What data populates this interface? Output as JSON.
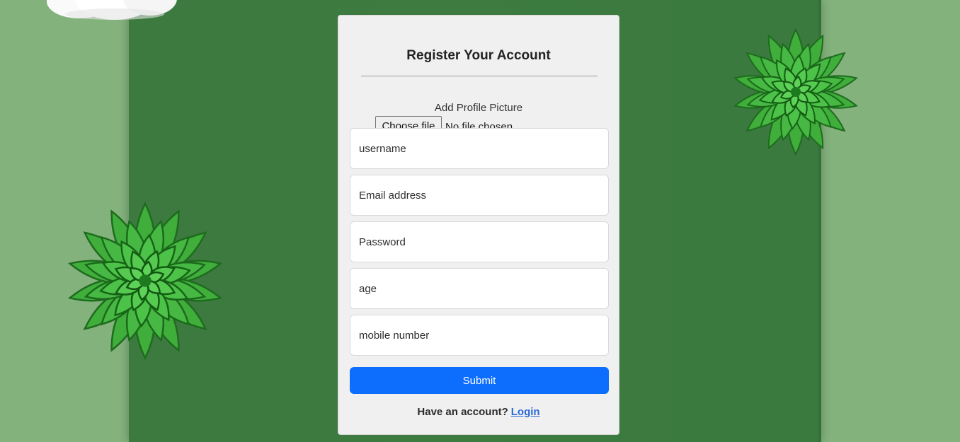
{
  "form": {
    "title": "Register Your Account",
    "profile_picture_label": "Add Profile Picture",
    "choose_file_label": "Choose file",
    "file_status": "No file chosen",
    "fields": [
      {
        "placeholder": "username",
        "value": ""
      },
      {
        "placeholder": "Email address",
        "value": ""
      },
      {
        "placeholder": "Password",
        "value": ""
      },
      {
        "placeholder": "age",
        "value": ""
      },
      {
        "placeholder": "mobile number",
        "value": ""
      }
    ],
    "submit_label": "Submit",
    "footer_text": "Have an account?",
    "login_link": "Login"
  },
  "colors": {
    "background": "#83b27c",
    "panel": "#3c7a3f",
    "card": "#f0f0f0",
    "accent": "#0d6efd",
    "link": "#2a6ad6"
  },
  "decorations": {
    "plants": [
      "succulent-icon",
      "succulent-icon"
    ],
    "cloud": "cloud-icon"
  }
}
